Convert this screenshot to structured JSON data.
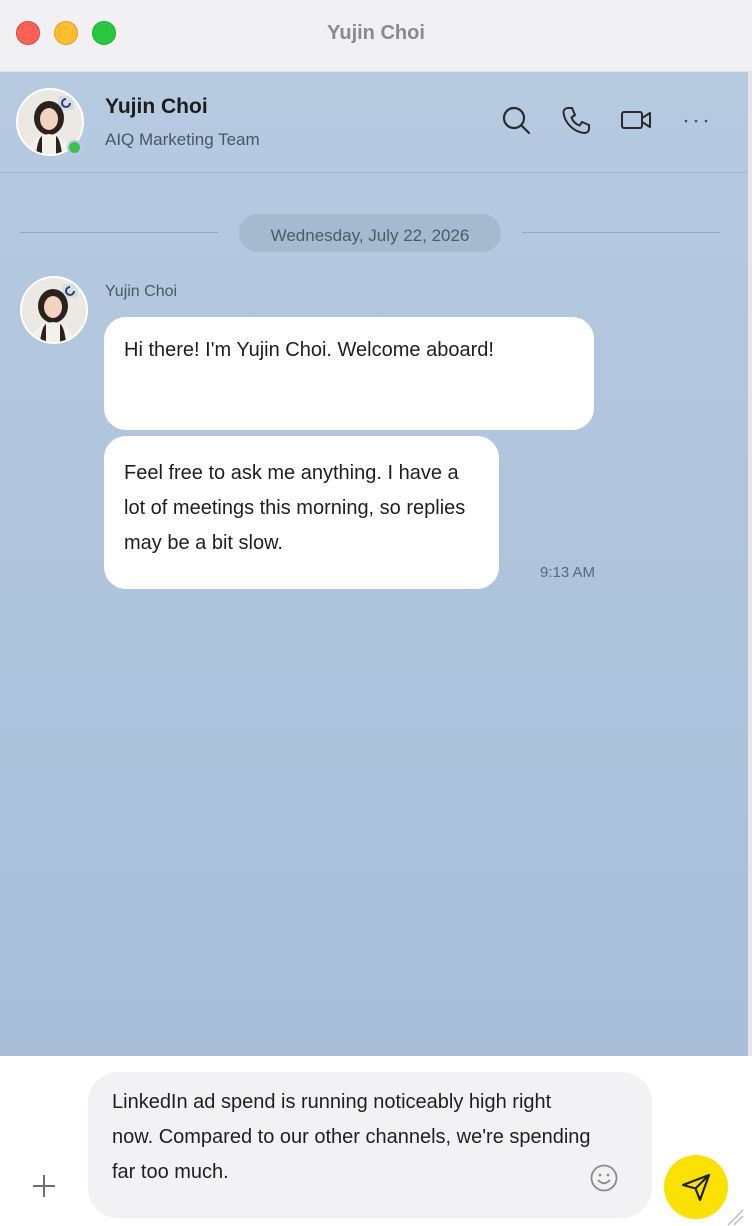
{
  "window": {
    "title": "Yujin Choi"
  },
  "header": {
    "name": "Yujin Choi",
    "team": "AIQ Marketing Team",
    "status": "online",
    "icons": [
      "search-icon",
      "phone-icon",
      "video-camera-icon",
      "more-icon"
    ]
  },
  "conversation": {
    "date": "Wednesday, July 22, 2026",
    "sender": "Yujin Choi",
    "messages": [
      {
        "text": "Hi there! I'm Yujin Choi. Welcome aboard!"
      },
      {
        "text": "Feel free to ask me anything. I have a lot of meetings this morning, so replies may be a bit slow."
      }
    ],
    "time": "9:13 AM"
  },
  "composer": {
    "draft": "LinkedIn ad spend is running noticeably high right now. Compared to our other channels, we're spending far too much.",
    "icons": [
      "plus-icon",
      "emoji-icon",
      "send-icon"
    ]
  },
  "colors": {
    "chat_bg": "#b6cae0",
    "send_button": "#fae100",
    "online": "#3cc14a"
  }
}
